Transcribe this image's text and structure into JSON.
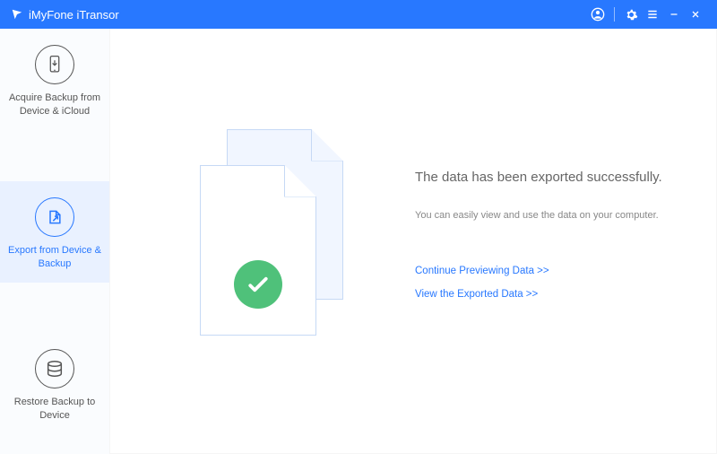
{
  "app": {
    "title": "iMyFone iTransor"
  },
  "sidebar": {
    "items": [
      {
        "label": "Acquire Backup from Device & iCloud"
      },
      {
        "label": "Export from Device & Backup"
      },
      {
        "label": "Restore Backup to Device"
      }
    ]
  },
  "main": {
    "heading": "The data has been exported successfully.",
    "sub": "You can easily view and use the data on your computer.",
    "link_continue": "Continue Previewing Data >>",
    "link_view": "View the Exported Data >>"
  }
}
